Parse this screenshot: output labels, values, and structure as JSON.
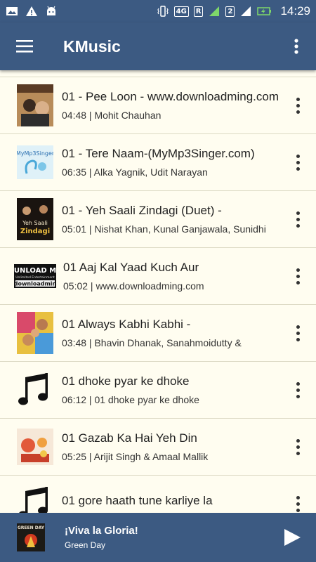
{
  "status": {
    "network": "4G",
    "roaming": "R",
    "sim": "2",
    "time": "14:29"
  },
  "app": {
    "title": "KMusic"
  },
  "songs": [
    {
      "title": "01 - Pee Loon - www.downloadming.com",
      "meta": "04:48 | Mohit Chauhan",
      "art": "album-art-pee-loon"
    },
    {
      "title": "01 - Tere Naam-(MyMp3Singer.com)",
      "meta": "06:35 | Alka Yagnik, Udit Narayan",
      "art": "album-art-tere-naam"
    },
    {
      "title": "01 - Yeh Saali Zindagi (Duet) -",
      "meta": "05:01 | Nishat Khan, Kunal Ganjawala, Sunidhi",
      "art": "album-art-yeh-saali-zindagi"
    },
    {
      "title": "01 Aaj Kal Yaad Kuch Aur",
      "meta": "05:02 | www.downloadming.com",
      "art": "album-art-downloadming"
    },
    {
      "title": "01 Always Kabhi Kabhi  -",
      "meta": "03:48 | Bhavin Dhanak, Sanahmoidutty &",
      "art": "album-art-always-kabhi-kabhi"
    },
    {
      "title": "01 dhoke pyar ke dhoke",
      "meta": "06:12 | 01 dhoke pyar ke dhoke",
      "art": "music-note-icon"
    },
    {
      "title": "01 Gazab Ka Hai Yeh Din",
      "meta": "05:25 | Arijit Singh & Amaal Mallik",
      "art": "album-art-gazab-ka-hai-yeh-din"
    },
    {
      "title": "01 gore haath tune karliye la",
      "meta": "",
      "art": "music-note-icon"
    }
  ],
  "thumb_text": {
    "downloadming_top": "UNLOAD M",
    "downloadming_mid": "Unlimited Entertainment",
    "downloadming_bottom": "downloadmin",
    "mymp3singer": "MyMp3Singer",
    "yeh_saali": "Yeh Saali",
    "zindagi": "Zindagi",
    "green_day": "GREEN DAY"
  },
  "player": {
    "title": "¡Viva la Gloria!",
    "artist": "Green Day"
  },
  "colors": {
    "bar": "#3c5a82",
    "background": "#fffdf0",
    "divider": "#dcd9c4"
  }
}
